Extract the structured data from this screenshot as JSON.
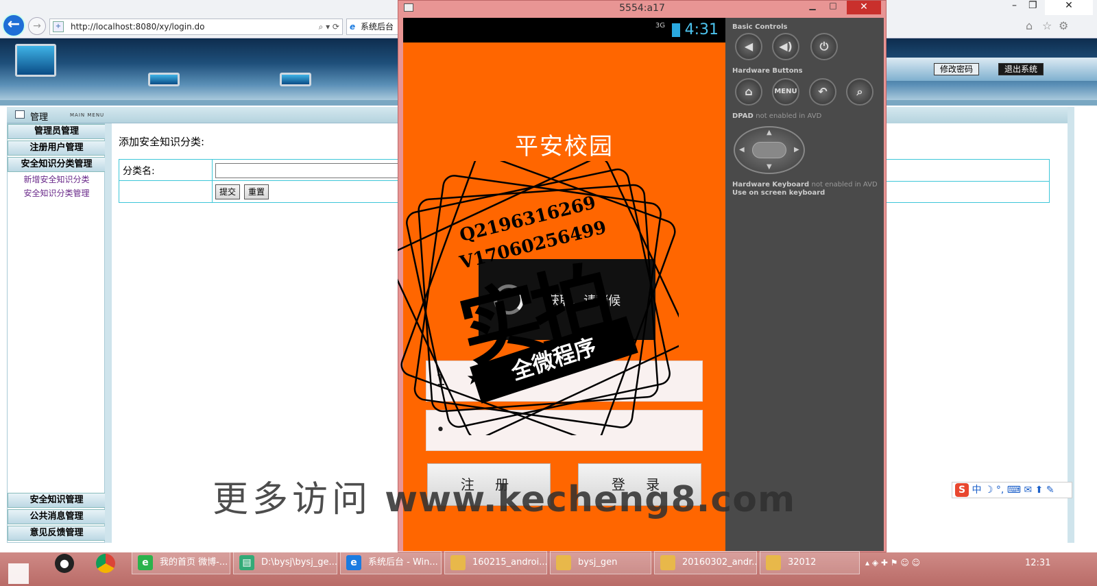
{
  "browser": {
    "url": "http://localhost:8080/xy/login.do",
    "tab_title": "系统后台",
    "window_controls": [
      "–",
      "❐",
      "✕"
    ]
  },
  "header": {
    "change_password": "修改密码",
    "logout": "退出系统"
  },
  "menu": {
    "title": "管理",
    "subtitle": "MAIN MENU",
    "items_top": [
      {
        "label": "管理员管理"
      },
      {
        "label": "注册用户管理"
      },
      {
        "label": "安全知识分类管理"
      }
    ],
    "subitems": [
      {
        "label": "新增安全知识分类"
      },
      {
        "label": "安全知识分类管理"
      }
    ],
    "items_bottom": [
      {
        "label": "安全知识管理"
      },
      {
        "label": "公共消息管理"
      },
      {
        "label": "意见反馈管理"
      }
    ]
  },
  "content": {
    "heading": "添加安全知识分类:",
    "field_label": "分类名:",
    "field_value": "",
    "submit": "提交",
    "reset": "重置"
  },
  "emulator": {
    "window_title": "5554:a17",
    "status_network": "3G",
    "status_time": "4:31",
    "app_title": "平安校园",
    "dialog_text": "获取...请稍候",
    "username_value": "1",
    "password_value": "•",
    "register": "注 册",
    "login": "登 录",
    "controls": {
      "basic_controls": "Basic Controls",
      "hardware_buttons": "Hardware Buttons",
      "dpad_label": "DPAD",
      "dpad_note": "not enabled in AVD",
      "keyboard_label": "Hardware Keyboard",
      "keyboard_note": "not enabled in AVD",
      "keyboard_hint": "Use on screen keyboard",
      "menu_btn": "MENU"
    }
  },
  "watermark": {
    "qq": "Q2196316269",
    "v": "V17060256499",
    "big": "实拍",
    "ribbon": "全微程序",
    "cn": "更多访问",
    "url": "www.kecheng8.com"
  },
  "ime": {
    "logo": "S",
    "mode": "中"
  },
  "taskbar": {
    "apps": [
      {
        "label": "我的首页 微博-..."
      },
      {
        "label": "D:\\bysj\\bysj_ge..."
      },
      {
        "label": "系统后台 - Win..."
      },
      {
        "label": "160215_androi..."
      },
      {
        "label": "bysj_gen"
      },
      {
        "label": "20160302_andr..."
      },
      {
        "label": "32012"
      }
    ],
    "time": "12:31"
  },
  "colors": {
    "phone_bg": "#ff6600",
    "emulator_frame": "#e89594",
    "form_border": "#3cc6d8",
    "menu_sub_link": "#6a2a8a"
  }
}
